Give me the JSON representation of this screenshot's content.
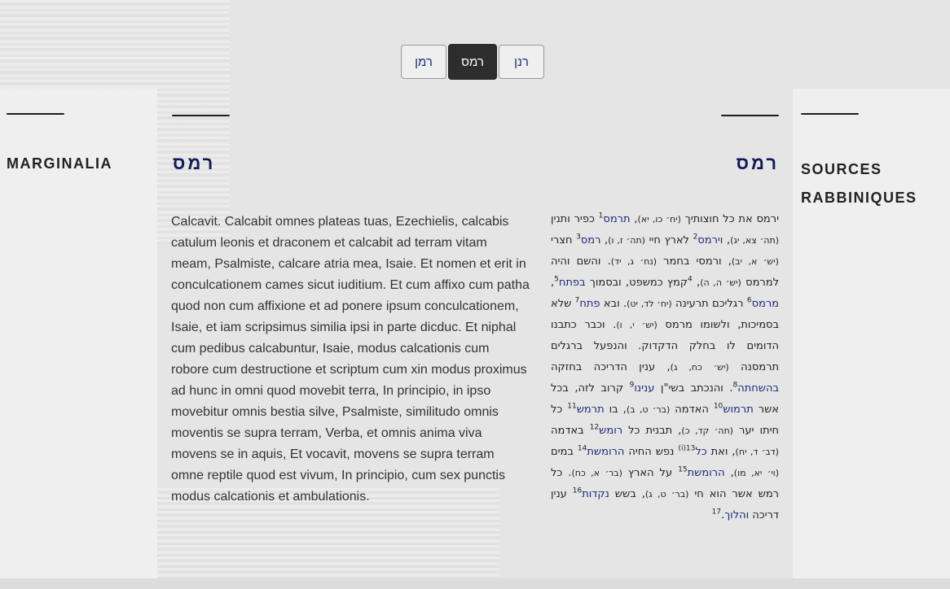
{
  "tabs": [
    {
      "label": "רמן"
    },
    {
      "label": "רמס",
      "active": true
    },
    {
      "label": "רנן"
    }
  ],
  "marginalia_title": "MARGINALIA",
  "sources_title_1": "SOURCES",
  "sources_title_2": "RABBINIQUES",
  "left_column_title": "רמס",
  "right_column_title": "רמס",
  "latin_text": "Calcavit. Calcabit omnes plateas tuas, Ezechielis, calcabis catulum leonis et draconem et calcabit ad terram vitam meam, Psalmiste, calcare atria mea, Isaie. Et nomen et erit in conculcationem cames sicut iuditium. Et cum affixo cum patha quod non cum affixione et ad ponere ipsum conculcationem, Isaie, et iam scripsimus similia ipsi in parte dicduc. Et niphal cum pedibus calcabuntur, Isaie, modus calcationis cum robore cum destructione et scriptum cum xin modus proximus ad hunc in omni quod movebit terra, In principio, in ipso movebitur omnis bestia silve, Psalmiste, similitudo omnis moventis se supra terram, Verba, et omnis anima viva movens se in aquis, Et vocavit, movens se supra terram omne reptile quod est vivum, In principio, cum sex punctis modus calcationis et ambulationis.",
  "hebrew": {
    "s1": "ירמס את כל חוצותיך ",
    "r1": "(יח׳ כו, יא)",
    "s2": ", ",
    "l1": "תרמס",
    "n1": "1",
    "s3": " כפיר ותנין ",
    "r2": "(תה׳ צא, יג)",
    "s4": ", ",
    "l2": "וירמס",
    "n2": "2",
    "s5": " לארץ חיי ",
    "r3": "(תה׳ ז, ו)",
    "s6": ", ",
    "l3": "רמס",
    "n3": "3",
    "s7": " חצרי ",
    "r4": "(יש׳ א, יב)",
    "s8": ", ורמסי בחמר ",
    "r5": "(נח׳ ג, יד)",
    "s9": ". והשם והיה למרמס ",
    "r6": "(יש׳ ה, ה)",
    "s10": ", ",
    "n4": "4",
    "s11": "קמץ כמשפט, ובסמוך ",
    "l4": "בפתח",
    "n5": "5",
    "s12": ", ",
    "l5": "מרמס",
    "n6": "6",
    "s13": " רגליכם תרעינה ",
    "r7": "(יח׳ לד, יט)",
    "s14": ". ובא ",
    "l6": "פתח",
    "n7": "7",
    "s15": " שלא בסמיכות, ולשומו מרמס ",
    "r8": "(יש׳ י, ו)",
    "s16": ". וכבר כתבנו הדומים לו בחלק הדקדוק. והנפעל ברגלים תרמסנה ",
    "r9": "(יש׳ כח, ג)",
    "s17": ", ענין הדריכה בחזקה ",
    "l7": "בהשחתה",
    "n8": "8",
    "s18": ". והנכתב בשי\"ן ",
    "l8": "ענינו",
    "n9": "9",
    "s19": " קרוב לזה, בכל אשר ",
    "l9": "תרמוש",
    "n10": "10",
    "s20": " האדמה ",
    "r10": "(בר׳ ט, ב)",
    "s21": ", בו ",
    "l10": "תרמש",
    "n11": "11",
    "s22": " כל חיתו יער ",
    "r11": "(תה׳ קד, כ)",
    "s23": ", תבנית כל ",
    "l11": "רומש",
    "n12": "12",
    "s24": " באדמה ",
    "r12": "(דב׳ ד, יח)",
    "s25": ", ואת ",
    "l12": "כל",
    "n13": "13(i)",
    "s26": " נפש החיה ",
    "l13": "הרומשת",
    "n14": "14",
    "s27": " במים ",
    "r13": "(וי׳ יא, מו)",
    "s28": ", ",
    "l14": "הרומשת",
    "n15": "15",
    "s29": " על הארץ ",
    "r14": "(בר׳ א, כח)",
    "s30": ". כל רמש אשר הוא חי ",
    "r15": "(בר׳ ט, ג)",
    "s31": ", בשש ",
    "l15": "נקדות",
    "n16": "16",
    "s32": " ענין דריכה ",
    "l16": "והלוך",
    "s33": ".",
    "n17": "17"
  }
}
